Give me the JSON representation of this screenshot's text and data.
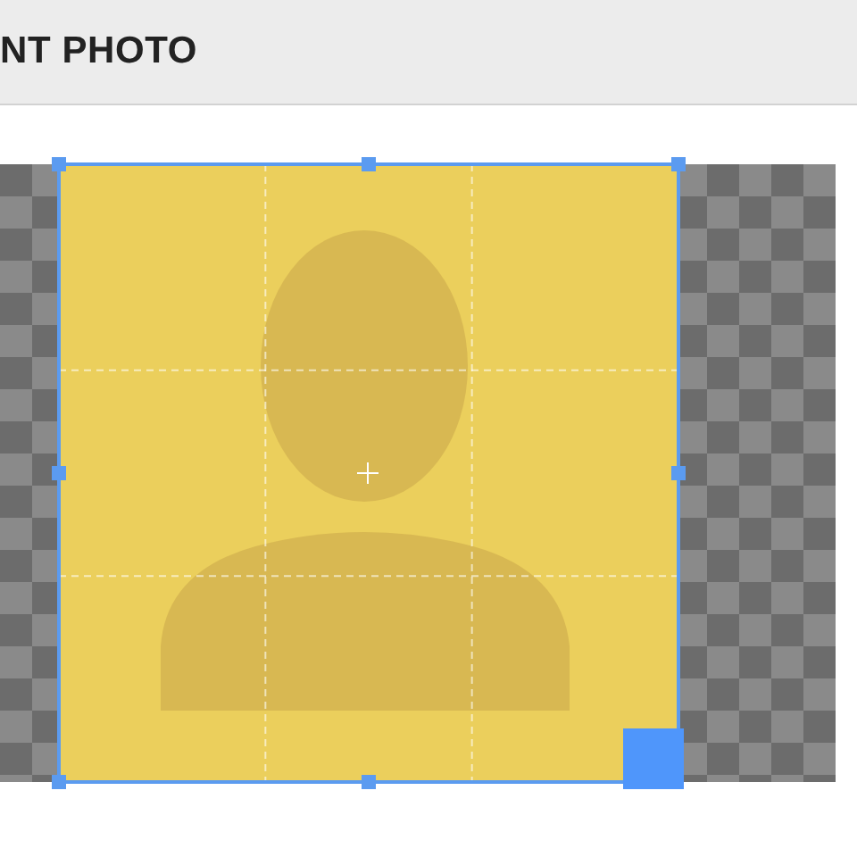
{
  "header": {
    "title": "NT PHOTO"
  }
}
